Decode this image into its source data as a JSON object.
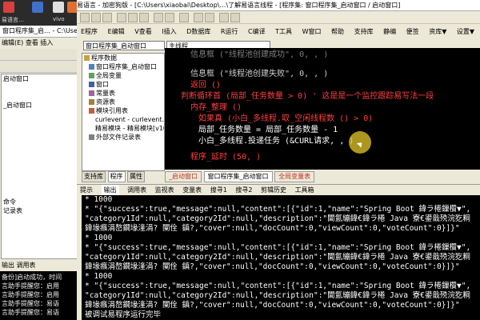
{
  "desktop": {
    "icons": [
      {
        "label": "易语言…",
        "color": "#d84040"
      },
      {
        "label": "",
        "color": "#4070c8"
      },
      {
        "label": "vivo",
        "color": "#e0e0e0"
      },
      {
        "label": "Postman",
        "color": "#e07030"
      }
    ]
  },
  "back_window": {
    "title": "窗口程序集_启… - C:\\Users\\xiaobai\\Desktop\\",
    "menu": [
      "编辑(E)",
      "查看",
      "插入",
      "数据库",
      "程序"
    ],
    "select_value": "主线程",
    "tree_items": [
      "启动窗口",
      "",
      "",
      "",
      "",
      "",
      "_启动窗口",
      "",
      ""
    ],
    "tree_tail": [
      "命令",
      "记录表"
    ],
    "panel_tabs": [
      "输出",
      "调用表",
      "监视表"
    ],
    "prop_tab": "属性",
    "output_lines": [
      "备份]启动成功，时间",
      "言助手提醒您：启用",
      "言助手提醒您：启用",
      "言助手提醒您：易语",
      "言助手提醒您：易语"
    ]
  },
  "main_window": {
    "title": "易语言 - 加密狗版 - [C:\\Users\\xiaobai\\Desktop\\…\\了解易语言线程 - [程序集: 窗口程序集_启动窗口 / 启动窗口]",
    "menu": [
      "E程序",
      "E编辑",
      "V查看",
      "I插入",
      "D数据库",
      "R运行",
      "C编译",
      "T工具",
      "W窗口",
      "帮助",
      "支持库",
      "静编",
      "便签",
      "资库▼",
      "设置▼"
    ],
    "select_left": "窗口程序集_启动窗口",
    "select_right": "主线程",
    "tree": {
      "items": [
        {
          "label": "程序数据",
          "level": 0
        },
        {
          "label": "窗口程序集_启动窗口",
          "level": 1
        },
        {
          "label": "全局变量",
          "level": 1
        },
        {
          "label": "窗口",
          "level": 1
        },
        {
          "label": "常量表",
          "level": 1
        },
        {
          "label": "资源表",
          "level": 1
        },
        {
          "label": "模块引用表",
          "level": 1
        },
        {
          "label": "curlevent - curlevent.ec",
          "level": 2
        },
        {
          "label": "精易模块 - 精易模块[v10",
          "level": 2
        },
        {
          "label": "外部文件记录表",
          "level": 1
        }
      ],
      "tabs": [
        "支持库",
        "程序",
        "属性"
      ]
    },
    "code_lines": [
      {
        "text": "信息框 (\"线程池创建成功\", 0, , )",
        "color": "#808080"
      },
      {
        "text": "",
        "color": "#ffffff"
      },
      {
        "text": "信息框 (\"线程池创建失败\", 0, , )",
        "color": "#d0d0d0"
      },
      {
        "text": "返回 ()",
        "color": "#ff4040"
      },
      {
        "text": "判断循环首 (局部_任务数量 > 0)  ' 这是是一个监控跟踪易写法一段",
        "color": "#ff4040"
      },
      {
        "text": "内存_整理 ()",
        "color": "#ff4040"
      },
      {
        "text": "如果真 (小白_多线程.取_空闲线程数 () > 0)",
        "color": "#ff4040"
      },
      {
        "text": "局部_任务数量 = 局部_任务数量 - 1",
        "color": "#ffffff"
      },
      {
        "text": "小白_多线程.投递任务 (&CURL请求, , )",
        "color": "#ffffff"
      },
      {
        "text": "",
        "color": "#ffffff"
      },
      {
        "text": "程序_延时 (50, )",
        "color": "#ff4040"
      }
    ],
    "editor_tabs": [
      "_启动窗口",
      "窗口程序集_启动窗口",
      "全局变量表"
    ],
    "output_tabs": [
      "提示",
      "输出",
      "调用表",
      "监视表",
      "变量表",
      "搜寻1",
      "搜寻2",
      "剪辑历史",
      "工具箱"
    ],
    "output_lines": [
      "* 1000",
      "* \"{\"success\":true,\"message\":null,\"content\":[{\"id\":1,\"name\":\"Spring Boot 鍏ラ棬鏁欑▼\",",
      "  \"category1Id\":null,\"category2Id\":null,\"description\":\"閫氳繃鍏€鍏ラ棬 Java 寮€鍙戠殑浣犵粡",
      "鍏堟瘯涓嶅鐗堟湰涓? 闃佺  鎮?,\"cover\":null,\"docCount\":0,\"viewCount\":0,\"voteCount\":0}]}\"",
      "* 1000",
      "* \"{\"success\":true,\"message\":null,\"content\":[{\"id\":1,\"name\":\"Spring Boot 鍏ラ棬鏁欑▼\",",
      "  \"category1Id\":null,\"category2Id\":null,\"description\":\"閫氳繃鍏€鍏ラ棬 Java 寮€鍙戠殑浣犵粡",
      "鍏堟瘯涓嶅鐗堟湰涓? 闃佺  鎮?,\"cover\":null,\"docCount\":0,\"viewCount\":0,\"voteCount\":0}]}\"",
      "* 1000",
      "* \"{\"success\":true,\"message\":null,\"content\":[{\"id\":1,\"name\":\"Spring Boot 鍏ラ棬鏁欑▼\",",
      "  \"category1Id\":null,\"category2Id\":null,\"description\":\"閫氳繃鍏€鍏ラ棬 Java 寮€鍙戠殑浣犵粡",
      "鍏堟瘯涓嶅鐗堟湰涓? 闃佺  鎮?,\"cover\":null,\"docCount\":0,\"viewCount\":0,\"voteCount\":0}]}\"",
      "被调试易程序运行完毕"
    ]
  },
  "colors": {
    "editor_bg": "#000000",
    "keyword": "#ff4040",
    "cursor_highlight": "#e6c828"
  }
}
